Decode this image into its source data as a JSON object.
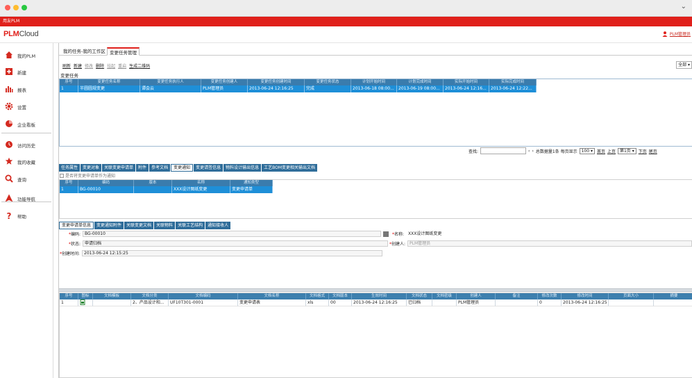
{
  "window": {
    "brand_bar": "用友PLM"
  },
  "header": {
    "logo_plm": "PLM",
    "logo_cloud": "Cloud",
    "user": "PLM管理员"
  },
  "sidebar": {
    "items": [
      {
        "label": "我的PLM",
        "icon": "home-icon"
      },
      {
        "label": "新建",
        "icon": "new-icon"
      },
      {
        "label": "报表",
        "icon": "report-icon"
      },
      {
        "label": "设置",
        "icon": "gear-icon"
      },
      {
        "label": "企业看板",
        "icon": "dashboard-icon"
      },
      {
        "label": "访问历史",
        "icon": "history-icon"
      },
      {
        "label": "我的收藏",
        "icon": "star-icon"
      },
      {
        "label": "查询",
        "icon": "search-icon"
      },
      {
        "label": "功能导航",
        "icon": "navigation-icon"
      },
      {
        "label": "帮助",
        "icon": "help-icon"
      }
    ]
  },
  "tabs": [
    {
      "label": "我的任务-我的工作区",
      "active": false
    },
    {
      "label": "变更任务管理",
      "active": true
    }
  ],
  "toolbar": {
    "items": [
      {
        "label": "刷新",
        "enabled": true
      },
      {
        "label": "新建",
        "enabled": true
      },
      {
        "label": "修改",
        "enabled": false
      },
      {
        "label": "删除",
        "enabled": true
      },
      {
        "label": "挂起",
        "enabled": false
      },
      {
        "label": "重启",
        "enabled": false
      },
      {
        "label": "生成二维码",
        "enabled": true
      }
    ],
    "filter": "全部"
  },
  "task_grid": {
    "title": "变更任务",
    "columns": [
      "序号",
      "变更任务名称",
      "变更任务执行人",
      "变更任务创建人",
      "变更任务创建时间",
      "变更任务状态",
      "计划开始时间",
      "计划完成时间",
      "实际开始时间",
      "实际完成时间"
    ],
    "rows": [
      [
        "1",
        "半圆圆规变更",
        "谭会云",
        "PLM管理员",
        "2013-06-24 12:16:25",
        "完成",
        "2013-06-18 08:00...",
        "2013-06-19 08:00...",
        "2013-06-24 12:16...",
        "2013-06-24 12:22..."
      ]
    ]
  },
  "pager": {
    "search_label": "查找:",
    "summary": "总数据量1条 每页显示",
    "page_size": "100",
    "first": "首页",
    "prev": "上页",
    "page": "第1页",
    "next": "下页",
    "last": "尾页"
  },
  "detail_tabs": [
    "任务属性",
    "变更对象",
    "关联变更申请单",
    "附件",
    "参考文档",
    "变更通知",
    "变更请签信息",
    "物料设计输出信息",
    "工艺BOM变更相关输出文档"
  ],
  "detail_active": "变更通知",
  "notice_checkbox": "是否将变更申请单作为通知",
  "notice_grid": {
    "columns": [
      "序号",
      "编码",
      "版本",
      "名称",
      "通知类型"
    ],
    "rows": [
      [
        "1",
        "BG-00010",
        "",
        "XXX设计图纸变更",
        "变更申请单"
      ]
    ]
  },
  "sub_tabs": [
    "变更申请单信息",
    "变更通知附件",
    "关联变更文档",
    "关联物料",
    "关联工艺结构",
    "通知接收人"
  ],
  "sub_active": "变更申请单信息",
  "form": {
    "code_label": "编码:",
    "code": "BG-00010",
    "name_label": "名称:",
    "name": "XXX设计图纸变更",
    "status_label": "状态:",
    "status": "申请归档",
    "creator_label": "创建人:",
    "creator": "PLM管理员",
    "created_label": "创建时间:",
    "created": "2013-06-24 12:15:25"
  },
  "doc_grid": {
    "columns": [
      "序号",
      "图标",
      "文档模板",
      "文档分类",
      "文档编码",
      "文档名称",
      "文档格式",
      "文档版本",
      "生效时间",
      "文档状态",
      "文档密级",
      "创建人",
      "备注",
      "修改次数",
      "修改时间",
      "页面大小",
      "摘要"
    ],
    "rows": [
      [
        "1",
        "",
        "",
        "2、产品设计和...",
        "UF10T301-0001",
        "变更申请表",
        "xls",
        "00",
        "2013-06-24 12:16:25",
        "已归档",
        "",
        "PLM管理员",
        "",
        "0",
        "2013-06-24 12:16:25",
        "",
        ""
      ]
    ]
  }
}
